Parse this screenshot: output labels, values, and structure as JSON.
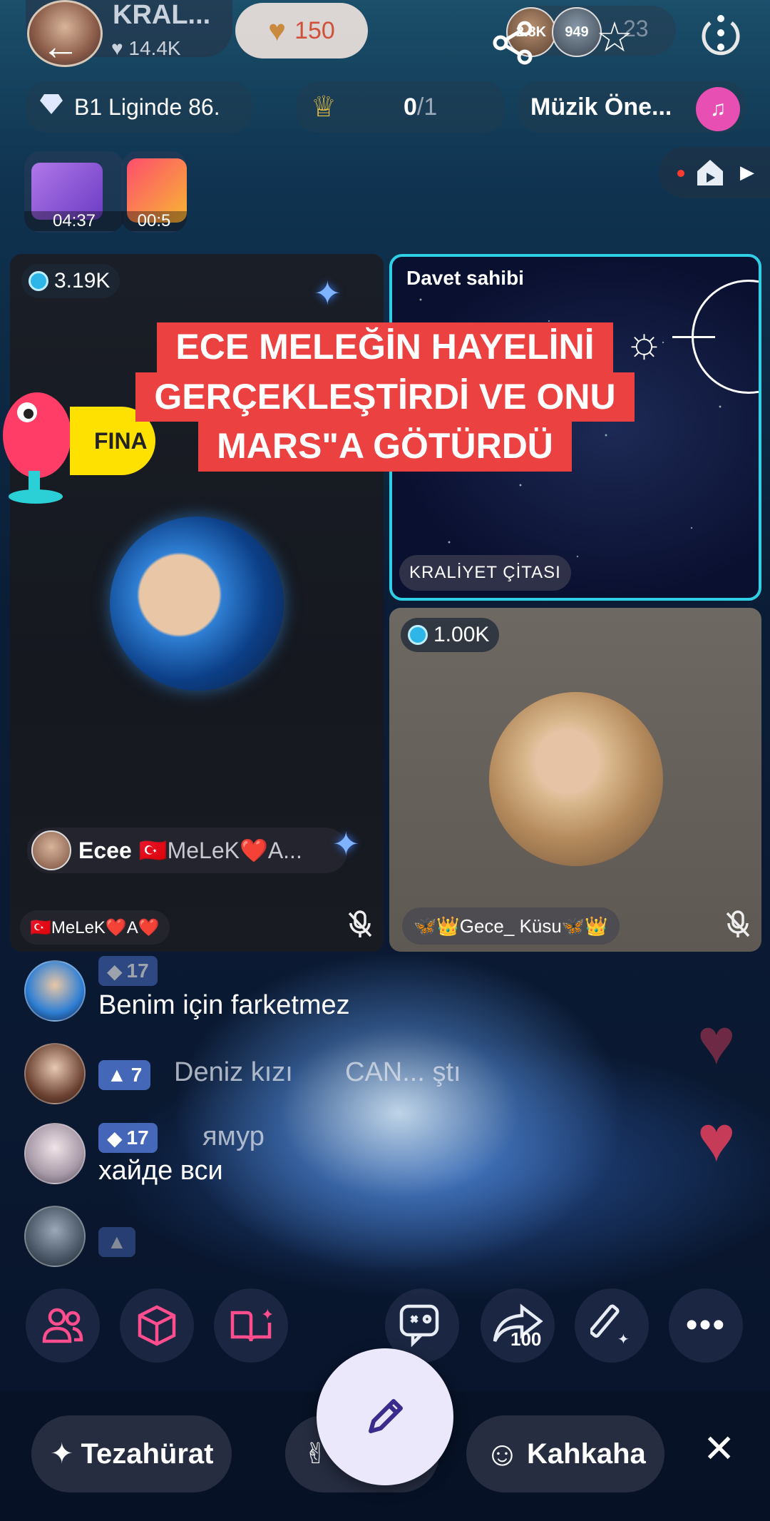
{
  "header": {
    "host_name": "KRAL...",
    "host_likes": "14.4K",
    "heart_count": "150",
    "viewer_badge_1": "2.8K",
    "viewer_badge_2": "949",
    "viewer_total": "23"
  },
  "status_row": {
    "league": "B1 Liginde 86.",
    "crown_score_main": "0",
    "crown_score_total": "/1",
    "music_label": "Müzik Öne..."
  },
  "gifts": [
    {
      "timer": "04:37",
      "icon": "gift-envelope-icon"
    },
    {
      "timer": "00:5",
      "icon": "music-gift-icon"
    }
  ],
  "tiles": {
    "main": {
      "count": "3.19K",
      "name": "Ecee",
      "name_rest": "🇹🇷MeLeK❤️A...",
      "sub_label": "🇹🇷MeLeK❤️A❤️"
    },
    "host": {
      "label": "Davet sahibi",
      "footer": "KRALİYET ÇİTASI"
    },
    "guest": {
      "count": "1.00K",
      "name": "🦋👑Gece_ Küsu🦋👑"
    }
  },
  "caption": {
    "line1": "ECE  MELEĞİN HAYELİNİ",
    "line2": "GERÇEKLEŞTİRDİ VE ONU",
    "line3": "MARS\"A GÖTÜRDÜ",
    "badge_text": "FINA"
  },
  "chat": [
    {
      "level": "17",
      "name": "",
      "message": "Benim için farketmez"
    },
    {
      "level": "7",
      "name": "Deniz kızı",
      "message": "CAN... ştı"
    },
    {
      "level": "17",
      "name": "ямур",
      "message": "хайде вси"
    },
    {
      "level": "",
      "name": "",
      "message": ""
    }
  ],
  "actions": {
    "compose_share_count": "100",
    "reactions": [
      "Tezahürat",
      "",
      "Kahkaha"
    ]
  },
  "colors": {
    "accent_pink": "#e84fb3",
    "caption_red": "#ec4141",
    "host_border": "#2fd0e6",
    "heart_red": "#e7405c"
  }
}
